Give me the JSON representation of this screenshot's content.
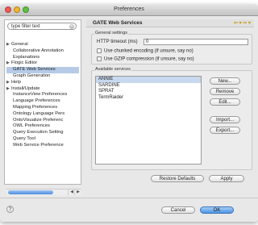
{
  "window": {
    "title": "Preferences"
  },
  "filter": {
    "value": "type filter text"
  },
  "tree": [
    {
      "label": "General",
      "arrow": "▶",
      "indent": false,
      "selected": false
    },
    {
      "label": "Collaborative Annotation",
      "arrow": "",
      "indent": true,
      "selected": false
    },
    {
      "label": "Explanations",
      "arrow": "",
      "indent": true,
      "selected": false
    },
    {
      "label": "Flogic Editor",
      "arrow": "▶",
      "indent": false,
      "selected": false
    },
    {
      "label": "GATE Web Services",
      "arrow": "",
      "indent": true,
      "selected": true
    },
    {
      "label": "Graph Generation",
      "arrow": "",
      "indent": true,
      "selected": false
    },
    {
      "label": "Help",
      "arrow": "▶",
      "indent": false,
      "selected": false
    },
    {
      "label": "Install/Update",
      "arrow": "▶",
      "indent": false,
      "selected": false
    },
    {
      "label": "InstanceView Preferences",
      "arrow": "",
      "indent": true,
      "selected": false
    },
    {
      "label": "Language Preferences",
      "arrow": "",
      "indent": true,
      "selected": false
    },
    {
      "label": "Mapping Preferences",
      "arrow": "",
      "indent": true,
      "selected": false
    },
    {
      "label": "Ontology Language Pers",
      "arrow": "",
      "indent": true,
      "selected": false
    },
    {
      "label": "OntoVisualize Preferenc",
      "arrow": "",
      "indent": true,
      "selected": false
    },
    {
      "label": "OWL Preferences",
      "arrow": "",
      "indent": true,
      "selected": false
    },
    {
      "label": "Query Execution Setting",
      "arrow": "",
      "indent": true,
      "selected": false
    },
    {
      "label": "Query Tool",
      "arrow": "",
      "indent": true,
      "selected": false
    },
    {
      "label": "Web Service Preference",
      "arrow": "",
      "indent": true,
      "selected": false
    }
  ],
  "page": {
    "title": "GATE Web Services",
    "nav_arrows": "⇦ ▾ ⇨ ▾",
    "general_group_label": "General settings",
    "timeout_label": "HTTP timeout (ms)",
    "timeout_value": "0",
    "chunked_label": "Use chunked encoding (if unsure, say no)",
    "gzip_label": "Use GZIP compression (if unsure, say no)",
    "services_group_label": "Available services",
    "services": [
      "ANNIE",
      "SARDINE",
      "SPRAT",
      "TermRaider"
    ],
    "buttons": {
      "new": "New...",
      "remove": "Remove",
      "edit": "Edit...",
      "import": "Import...",
      "export": "Export...",
      "restore": "Restore Defaults",
      "apply": "Apply"
    }
  },
  "footer": {
    "help": "?",
    "cancel": "Cancel",
    "ok": "OK"
  }
}
